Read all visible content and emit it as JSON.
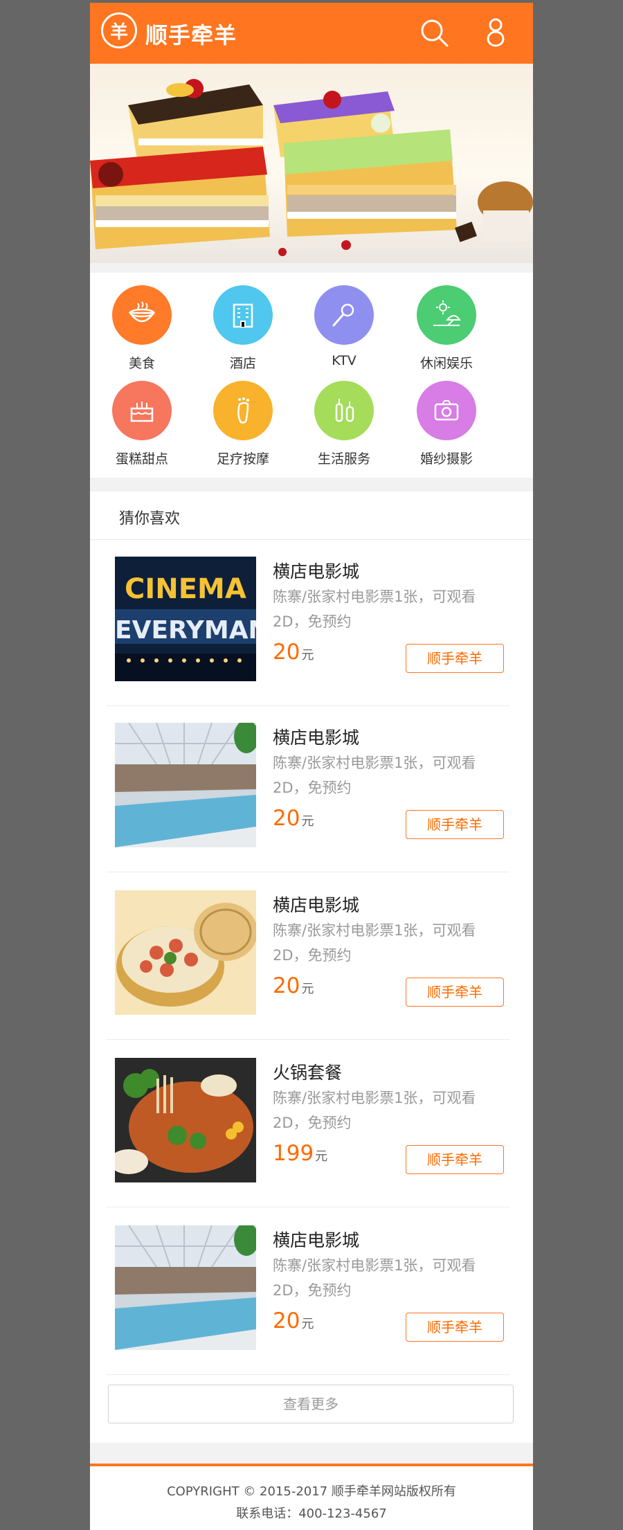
{
  "header": {
    "brand": "顺手牵羊",
    "logo_char": "羊",
    "search_icon": "search-icon",
    "user_icon": "user-icon",
    "accent": "#ff7520"
  },
  "categories": [
    {
      "label": "美食",
      "icon": "bowl-icon",
      "color": "#ff7a29"
    },
    {
      "label": "酒店",
      "icon": "hotel-icon",
      "color": "#4fc7ee"
    },
    {
      "label": "KTV",
      "icon": "microphone-icon",
      "color": "#8f8ff0"
    },
    {
      "label": "休闲娱乐",
      "icon": "beach-umbrella-icon",
      "color": "#4ccc73"
    },
    {
      "label": "蛋糕甜点",
      "icon": "cake-icon",
      "color": "#f6765e"
    },
    {
      "label": "足疗按摩",
      "icon": "foot-icon",
      "color": "#f8b22c"
    },
    {
      "label": "生活服务",
      "icon": "bottles-icon",
      "color": "#a5dc5a"
    },
    {
      "label": "婚纱摄影",
      "icon": "camera-icon",
      "color": "#d87ce6"
    }
  ],
  "section_title": "猜你喜欢",
  "items": [
    {
      "title": "横店电影城",
      "desc": "陈寨/张家村电影票1张，可观看2D，免预约",
      "price": "20",
      "unit": "元",
      "button": "顺手牵羊",
      "image": "cinema"
    },
    {
      "title": "横店电影城",
      "desc": "陈寨/张家村电影票1张，可观看2D，免预约",
      "price": "20",
      "unit": "元",
      "button": "顺手牵羊",
      "image": "pool"
    },
    {
      "title": "横店电影城",
      "desc": "陈寨/张家村电影票1张，可观看2D，免预约",
      "price": "20",
      "unit": "元",
      "button": "顺手牵羊",
      "image": "dimsum"
    },
    {
      "title": "火锅套餐",
      "desc": "陈寨/张家村电影票1张，可观看2D，免预约",
      "price": "199",
      "unit": "元",
      "button": "顺手牵羊",
      "image": "hotpot"
    },
    {
      "title": "横店电影城",
      "desc": "陈寨/张家村电影票1张，可观看2D，免预约",
      "price": "20",
      "unit": "元",
      "button": "顺手牵羊",
      "image": "pool"
    }
  ],
  "more_button": "查看更多",
  "footer": {
    "copyright": "COPYRIGHT © 2015-2017 顺手牵羊网站版权所有",
    "phone": "联系电话：400-123-4567"
  },
  "cinema_sign": {
    "line1": "CINEMA",
    "line2": "EVERYMAN"
  }
}
